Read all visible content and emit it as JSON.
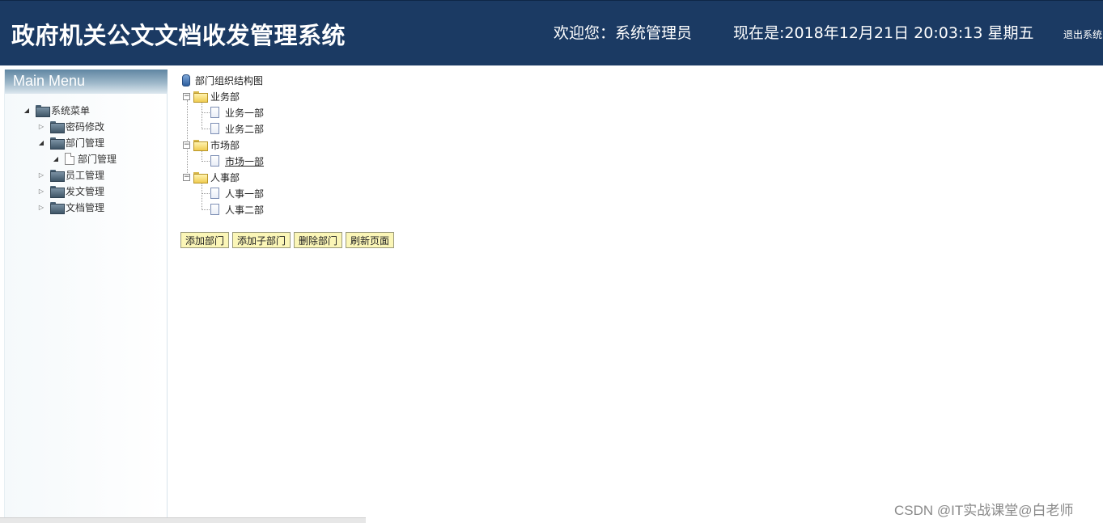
{
  "header": {
    "title": "政府机关公文文档收发管理系统",
    "welcome": "欢迎您：系统管理员",
    "datetime": "现在是:2018年12月21日 20:03:13 星期五",
    "logout": "退出系统"
  },
  "sidebar": {
    "heading": "Main Menu",
    "root": "系统菜单",
    "items": [
      {
        "label": "密码修改",
        "icon": "folder-icon",
        "expanded": false
      },
      {
        "label": "部门管理",
        "icon": "folder-icon",
        "expanded": true
      },
      {
        "label": "部门管理",
        "icon": "document-icon",
        "expanded": true
      },
      {
        "label": "员工管理",
        "icon": "folder-icon",
        "expanded": false
      },
      {
        "label": "发文管理",
        "icon": "folder-icon",
        "expanded": false
      },
      {
        "label": "文档管理",
        "icon": "folder-icon",
        "expanded": false
      }
    ]
  },
  "tree": {
    "root": "部门组织结构图",
    "departments": [
      {
        "name": "业务部",
        "children": [
          "业务一部",
          "业务二部"
        ]
      },
      {
        "name": "市场部",
        "children": [
          "市场一部"
        ]
      },
      {
        "name": "人事部",
        "children": [
          "人事一部",
          "人事二部"
        ]
      }
    ]
  },
  "buttons": {
    "add": "添加部门",
    "add_sub": "添加子部门",
    "delete": "删除部门",
    "refresh": "刷新页面"
  },
  "watermark": "CSDN @IT实战课堂@白老师",
  "colors": {
    "header_bg": "#1b3a63",
    "button_bg": "#fbf6b7"
  }
}
